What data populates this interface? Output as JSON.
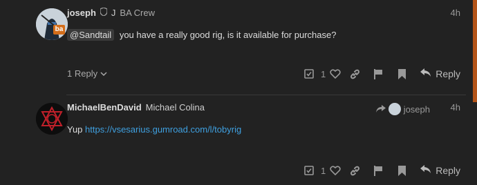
{
  "post1": {
    "username": "joseph",
    "user_title": "J",
    "group": "BA Crew",
    "flair": "ba",
    "date": "4h",
    "mention": "@Sandtail",
    "text": "you have a really good rig, is it available for purchase?",
    "replies_label": "1 Reply",
    "like_count": "1",
    "reply_label": "Reply"
  },
  "post2": {
    "username": "MichaelBenDavid",
    "fullname": "Michael Colina",
    "reply_to_user": "joseph",
    "date": "4h",
    "text_prefix": "Yup",
    "link": "https://vsesarius.gumroad.com/l/tobyrig",
    "like_count": "1",
    "reply_label": "Reply"
  },
  "icons": [
    "shield-icon",
    "check-square-icon",
    "heart-icon",
    "link-icon",
    "flag-icon",
    "bookmark-icon",
    "reply-icon",
    "chevron-down-icon"
  ]
}
